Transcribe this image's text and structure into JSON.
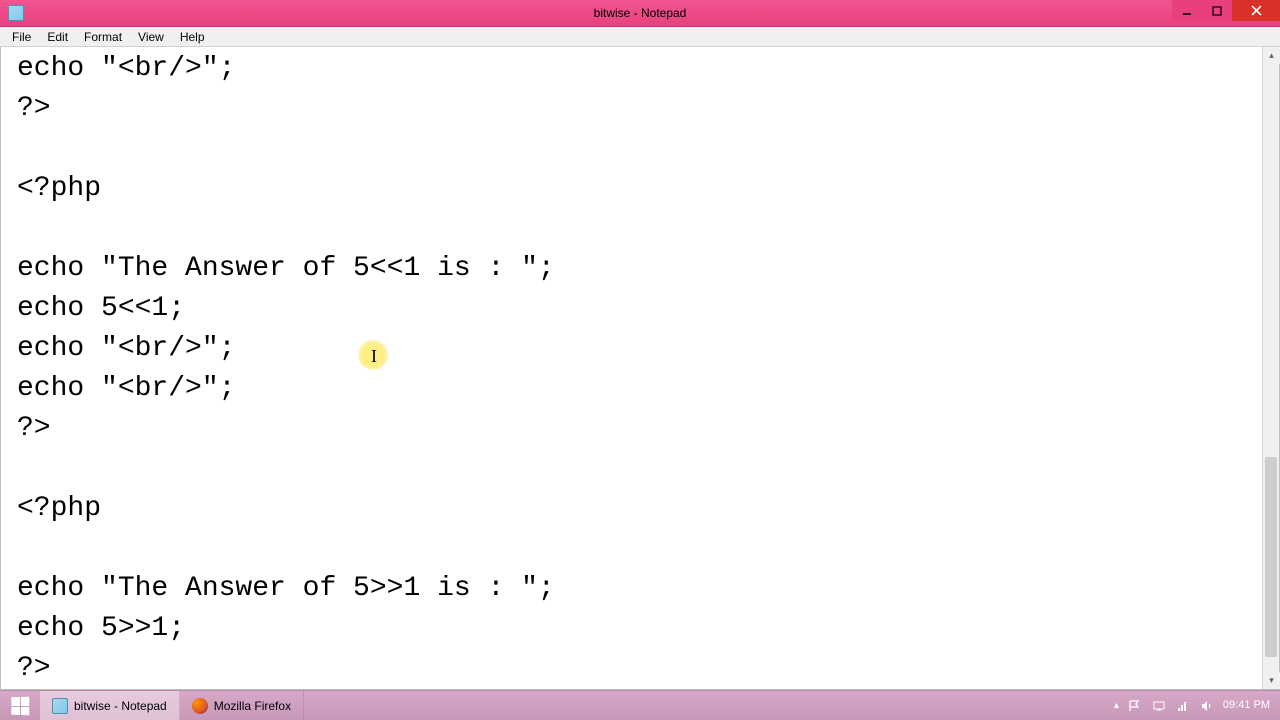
{
  "window": {
    "title": "bitwise - Notepad"
  },
  "menu": {
    "file": "File",
    "edit": "Edit",
    "format": "Format",
    "view": "View",
    "help": "Help"
  },
  "editor": {
    "content": "echo \"<br/>\";\n?>\n\n<?php\n\necho \"The Answer of 5<<1 is : \";\necho 5<<1;\necho \"<br/>\";\necho \"<br/>\";\n?>\n\n<?php\n\necho \"The Answer of 5>>1 is : \";\necho 5>>1;\n?>"
  },
  "taskbar": {
    "items": [
      {
        "label": "bitwise - Notepad"
      },
      {
        "label": "Mozilla Firefox"
      }
    ]
  },
  "systray": {
    "time": "09:41 PM"
  }
}
